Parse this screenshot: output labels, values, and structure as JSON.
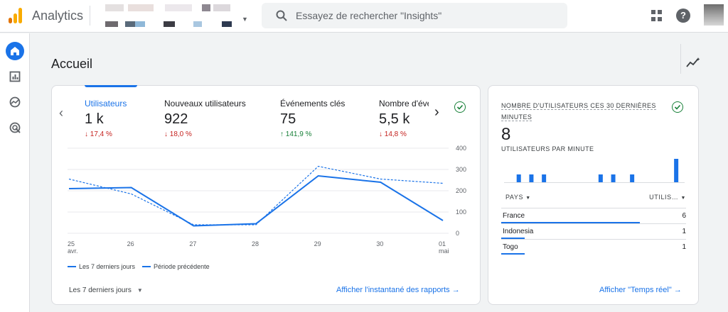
{
  "header": {
    "app_title": "Analytics",
    "search_placeholder": "Essayez de rechercher \"Insights\""
  },
  "page": {
    "title": "Accueil"
  },
  "metrics": [
    {
      "label": "Utilisateurs",
      "value": "1 k",
      "delta": "↓ 17,4 %",
      "dir": "down"
    },
    {
      "label": "Nouveaux utilisateurs",
      "value": "922",
      "delta": "↓ 18,0 %",
      "dir": "down"
    },
    {
      "label": "Événements clés",
      "value": "75",
      "delta": "↑ 141,9 %",
      "dir": "up"
    },
    {
      "label": "Nombre d'évé",
      "value": "5,5 k",
      "delta": "↓ 14,8 %",
      "dir": "down"
    }
  ],
  "chart_data": {
    "type": "line",
    "x": [
      "25 avr.",
      "26",
      "27",
      "28",
      "29",
      "30",
      "01 mai"
    ],
    "x_tick_labels": [
      [
        "25",
        "avr."
      ],
      [
        "26"
      ],
      [
        "27"
      ],
      [
        "28"
      ],
      [
        "29"
      ],
      [
        "30"
      ],
      [
        "01",
        "mai"
      ]
    ],
    "y_ticks": [
      "400",
      "300",
      "200",
      "100",
      "0"
    ],
    "ylim": [
      0,
      400
    ],
    "series": [
      {
        "name": "Les 7 derniers jours",
        "style": "solid",
        "values": [
          210,
          215,
          35,
          45,
          270,
          240,
          60
        ]
      },
      {
        "name": "Période précédente",
        "style": "dashed",
        "values": [
          255,
          185,
          40,
          40,
          315,
          255,
          235
        ]
      }
    ],
    "color": "#1a73e8",
    "grid": true
  },
  "legend": {
    "current": "Les 7 derniers jours",
    "previous": "Période précédente"
  },
  "footer": {
    "period_label": "Les 7 derniers jours",
    "report_link": "Afficher l'instantané des rapports",
    "arrow": "→"
  },
  "realtime": {
    "title": "Nombre d'utilisateurs ces 30 dernières minutes",
    "value": "8",
    "subtitle": "UTILISATEURS PAR MINUTE",
    "per_minute": [
      0,
      0,
      1,
      0,
      1,
      0,
      1,
      0,
      0,
      0,
      0,
      0,
      0,
      0,
      0,
      1,
      0,
      1,
      0,
      0,
      1,
      0,
      0,
      0,
      0,
      0,
      0,
      3
    ],
    "col_country": "PAYS",
    "col_users": "UTILIS…",
    "rows": [
      {
        "country": "France",
        "value": "6",
        "share": 0.75
      },
      {
        "country": "Indonesia",
        "value": "1",
        "share": 0.125
      },
      {
        "country": "Togo",
        "value": "1",
        "share": 0.125
      }
    ],
    "link": "Afficher \"Temps réel\"",
    "arrow": "→"
  },
  "colors": {
    "accent": "#1a73e8",
    "down": "#c5221f",
    "up": "#188038",
    "logo_orange": "#f9ab00",
    "logo_dark": "#e37400"
  }
}
